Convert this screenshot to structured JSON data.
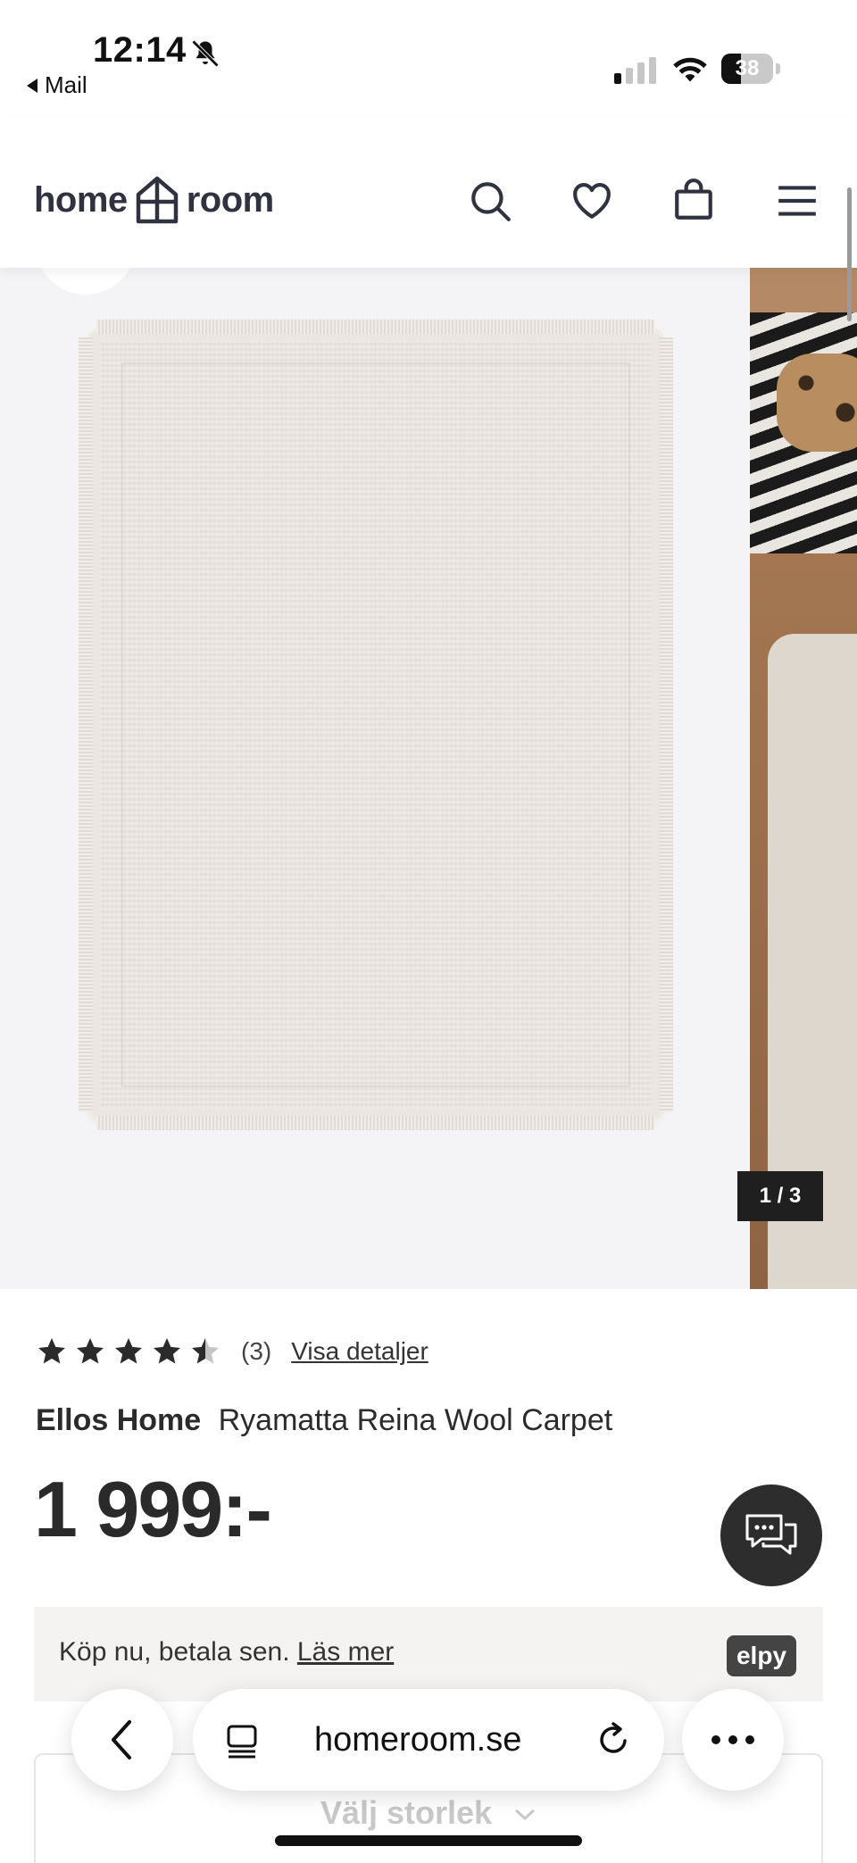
{
  "status_bar": {
    "time": "12:14",
    "back_app": "Mail",
    "battery": "38",
    "battery_level": 0.38
  },
  "header": {
    "logo_left": "home",
    "logo_right": "room",
    "icons": [
      "search-icon",
      "heart-icon",
      "bag-icon",
      "menu-icon"
    ]
  },
  "gallery": {
    "counter": "1 / 3",
    "current": 1,
    "total": 3
  },
  "product": {
    "rating": 4.5,
    "review_count": "(3)",
    "details_link": "Visa detaljer",
    "brand": "Ellos Home",
    "name": "Ryamatta Reina Wool Carpet",
    "price": "1 999:-"
  },
  "payment": {
    "text": "Köp nu, betala sen.",
    "link": "Läs mer",
    "badge": "elpy"
  },
  "size_selector": {
    "label": "Välj storlek"
  },
  "browser": {
    "url": "homeroom.se"
  },
  "colors": {
    "text_dark": "#2b2b2b",
    "gallery_bg": "#f4f4f6",
    "payment_bg": "#f5f3f1",
    "chat_button": "#2d2d2d",
    "counter_bg": "#1f1f1f"
  }
}
